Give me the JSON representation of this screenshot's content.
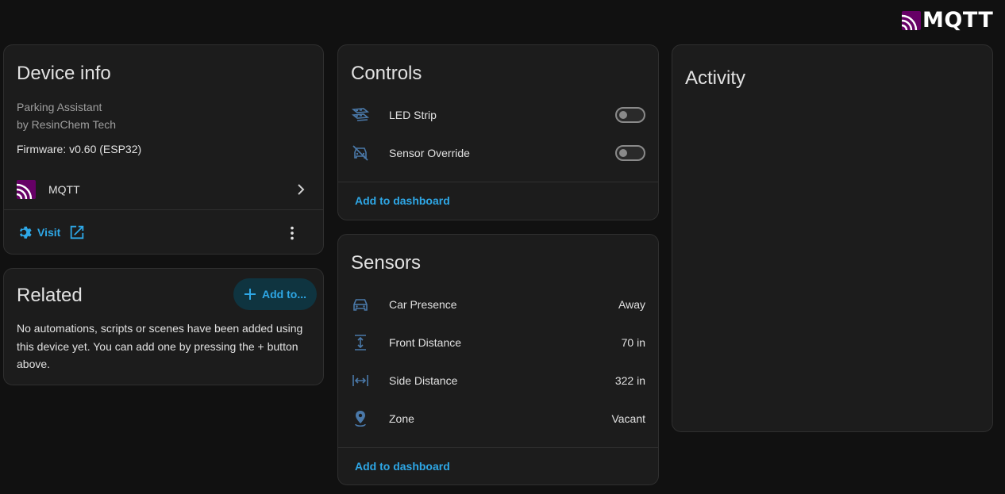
{
  "header": {
    "brand_label": "MQTT"
  },
  "device_info": {
    "title": "Device info",
    "model": "Parking Assistant",
    "manufacturer": "by ResinChem Tech",
    "firmware": "Firmware: v0.60 (ESP32)",
    "integration_label": "MQTT",
    "visit_label": "Visit"
  },
  "related": {
    "title": "Related",
    "add_label": "Add to...",
    "empty_text": "No automations, scripts or scenes have been added using this device yet. You can add one by pressing the + button above."
  },
  "controls": {
    "title": "Controls",
    "items": [
      {
        "label": "LED Strip",
        "icon": "led-strip-icon",
        "on": false
      },
      {
        "label": "Sensor Override",
        "icon": "car-off-icon",
        "on": false
      }
    ],
    "add_to_dashboard": "Add to dashboard"
  },
  "sensors": {
    "title": "Sensors",
    "items": [
      {
        "label": "Car Presence",
        "value": "Away",
        "icon": "car-icon"
      },
      {
        "label": "Front Distance",
        "value": "70 in",
        "icon": "vertical-distance-icon"
      },
      {
        "label": "Side Distance",
        "value": "322 in",
        "icon": "horizontal-distance-icon"
      },
      {
        "label": "Zone",
        "value": "Vacant",
        "icon": "map-marker-icon"
      }
    ],
    "add_to_dashboard": "Add to dashboard"
  },
  "activity": {
    "title": "Activity"
  },
  "colors": {
    "accent": "#2ea7e6",
    "icon_blue": "#4a78a8",
    "mqtt_purple": "#660066"
  }
}
